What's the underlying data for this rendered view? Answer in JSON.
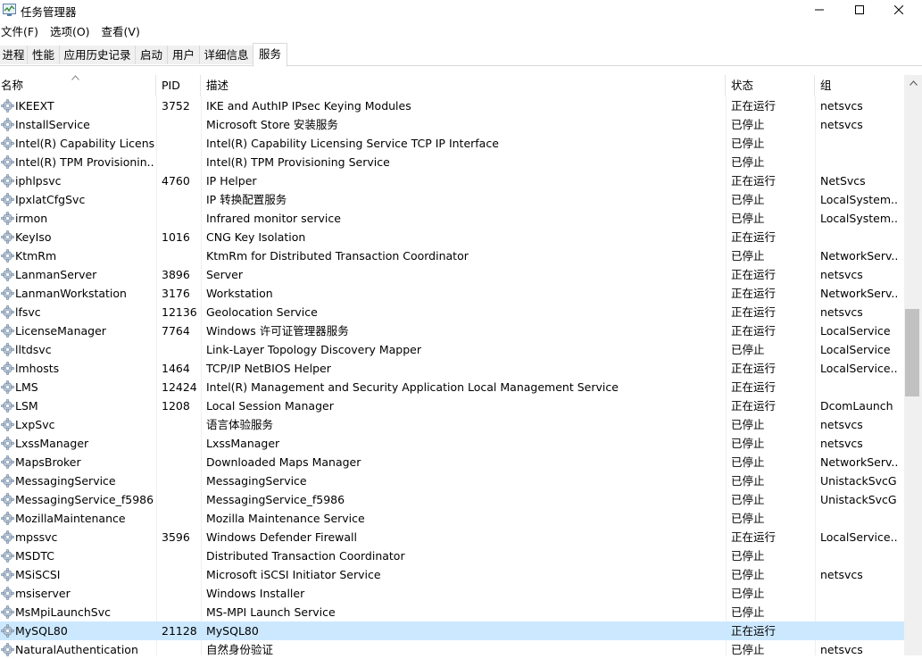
{
  "window": {
    "title": "任务管理器",
    "icon": "task-manager-icon"
  },
  "menu": [
    "文件(F)",
    "选项(O)",
    "查看(V)"
  ],
  "tabs": [
    {
      "label": "进程"
    },
    {
      "label": "性能"
    },
    {
      "label": "应用历史记录"
    },
    {
      "label": "启动"
    },
    {
      "label": "用户"
    },
    {
      "label": "详细信息"
    },
    {
      "label": "服务",
      "active": true
    }
  ],
  "columns": {
    "name": "名称",
    "pid": "PID",
    "desc": "描述",
    "state": "状态",
    "group": "组"
  },
  "selected_index": 28,
  "services": [
    {
      "name": "IKEEXT",
      "pid": "3752",
      "desc": "IKE and AuthIP IPsec Keying Modules",
      "state": "正在运行",
      "group": "netsvcs"
    },
    {
      "name": "InstallService",
      "pid": "",
      "desc": "Microsoft Store 安装服务",
      "state": "已停止",
      "group": "netsvcs"
    },
    {
      "name": "Intel(R) Capability Licensi...",
      "pid": "",
      "desc": "Intel(R) Capability Licensing Service TCP IP Interface",
      "state": "已停止",
      "group": ""
    },
    {
      "name": "Intel(R) TPM Provisionin...",
      "pid": "",
      "desc": "Intel(R) TPM Provisioning Service",
      "state": "已停止",
      "group": ""
    },
    {
      "name": "iphlpsvc",
      "pid": "4760",
      "desc": "IP Helper",
      "state": "正在运行",
      "group": "NetSvcs"
    },
    {
      "name": "IpxlatCfgSvc",
      "pid": "",
      "desc": "IP 转换配置服务",
      "state": "已停止",
      "group": "LocalSystem..."
    },
    {
      "name": "irmon",
      "pid": "",
      "desc": "Infrared monitor service",
      "state": "已停止",
      "group": "LocalSystem..."
    },
    {
      "name": "KeyIso",
      "pid": "1016",
      "desc": "CNG Key Isolation",
      "state": "正在运行",
      "group": ""
    },
    {
      "name": "KtmRm",
      "pid": "",
      "desc": "KtmRm for Distributed Transaction Coordinator",
      "state": "已停止",
      "group": "NetworkServ..."
    },
    {
      "name": "LanmanServer",
      "pid": "3896",
      "desc": "Server",
      "state": "正在运行",
      "group": "netsvcs"
    },
    {
      "name": "LanmanWorkstation",
      "pid": "3176",
      "desc": "Workstation",
      "state": "正在运行",
      "group": "NetworkServ..."
    },
    {
      "name": "lfsvc",
      "pid": "12136",
      "desc": "Geolocation Service",
      "state": "正在运行",
      "group": "netsvcs"
    },
    {
      "name": "LicenseManager",
      "pid": "7764",
      "desc": "Windows 许可证管理器服务",
      "state": "正在运行",
      "group": "LocalService"
    },
    {
      "name": "lltdsvc",
      "pid": "",
      "desc": "Link-Layer Topology Discovery Mapper",
      "state": "已停止",
      "group": "LocalService"
    },
    {
      "name": "lmhosts",
      "pid": "1464",
      "desc": "TCP/IP NetBIOS Helper",
      "state": "正在运行",
      "group": "LocalService..."
    },
    {
      "name": "LMS",
      "pid": "12424",
      "desc": "Intel(R) Management and Security Application Local Management Service",
      "state": "正在运行",
      "group": ""
    },
    {
      "name": "LSM",
      "pid": "1208",
      "desc": "Local Session Manager",
      "state": "正在运行",
      "group": "DcomLaunch"
    },
    {
      "name": "LxpSvc",
      "pid": "",
      "desc": "语言体验服务",
      "state": "已停止",
      "group": "netsvcs"
    },
    {
      "name": "LxssManager",
      "pid": "",
      "desc": "LxssManager",
      "state": "已停止",
      "group": "netsvcs"
    },
    {
      "name": "MapsBroker",
      "pid": "",
      "desc": "Downloaded Maps Manager",
      "state": "已停止",
      "group": "NetworkServ..."
    },
    {
      "name": "MessagingService",
      "pid": "",
      "desc": "MessagingService",
      "state": "已停止",
      "group": "UnistackSvcG..."
    },
    {
      "name": "MessagingService_f5986",
      "pid": "",
      "desc": "MessagingService_f5986",
      "state": "已停止",
      "group": "UnistackSvcG..."
    },
    {
      "name": "MozillaMaintenance",
      "pid": "",
      "desc": "Mozilla Maintenance Service",
      "state": "已停止",
      "group": ""
    },
    {
      "name": "mpssvc",
      "pid": "3596",
      "desc": "Windows Defender Firewall",
      "state": "正在运行",
      "group": "LocalService..."
    },
    {
      "name": "MSDTC",
      "pid": "",
      "desc": "Distributed Transaction Coordinator",
      "state": "已停止",
      "group": ""
    },
    {
      "name": "MSiSCSI",
      "pid": "",
      "desc": "Microsoft iSCSI Initiator Service",
      "state": "已停止",
      "group": "netsvcs"
    },
    {
      "name": "msiserver",
      "pid": "",
      "desc": "Windows Installer",
      "state": "已停止",
      "group": ""
    },
    {
      "name": "MsMpiLaunchSvc",
      "pid": "",
      "desc": "MS-MPI Launch Service",
      "state": "已停止",
      "group": ""
    },
    {
      "name": "MySQL80",
      "pid": "21128",
      "desc": "MySQL80",
      "state": "正在运行",
      "group": ""
    },
    {
      "name": "NaturalAuthentication",
      "pid": "",
      "desc": "自然身份验证",
      "state": "已停止",
      "group": "netsvcs"
    }
  ]
}
